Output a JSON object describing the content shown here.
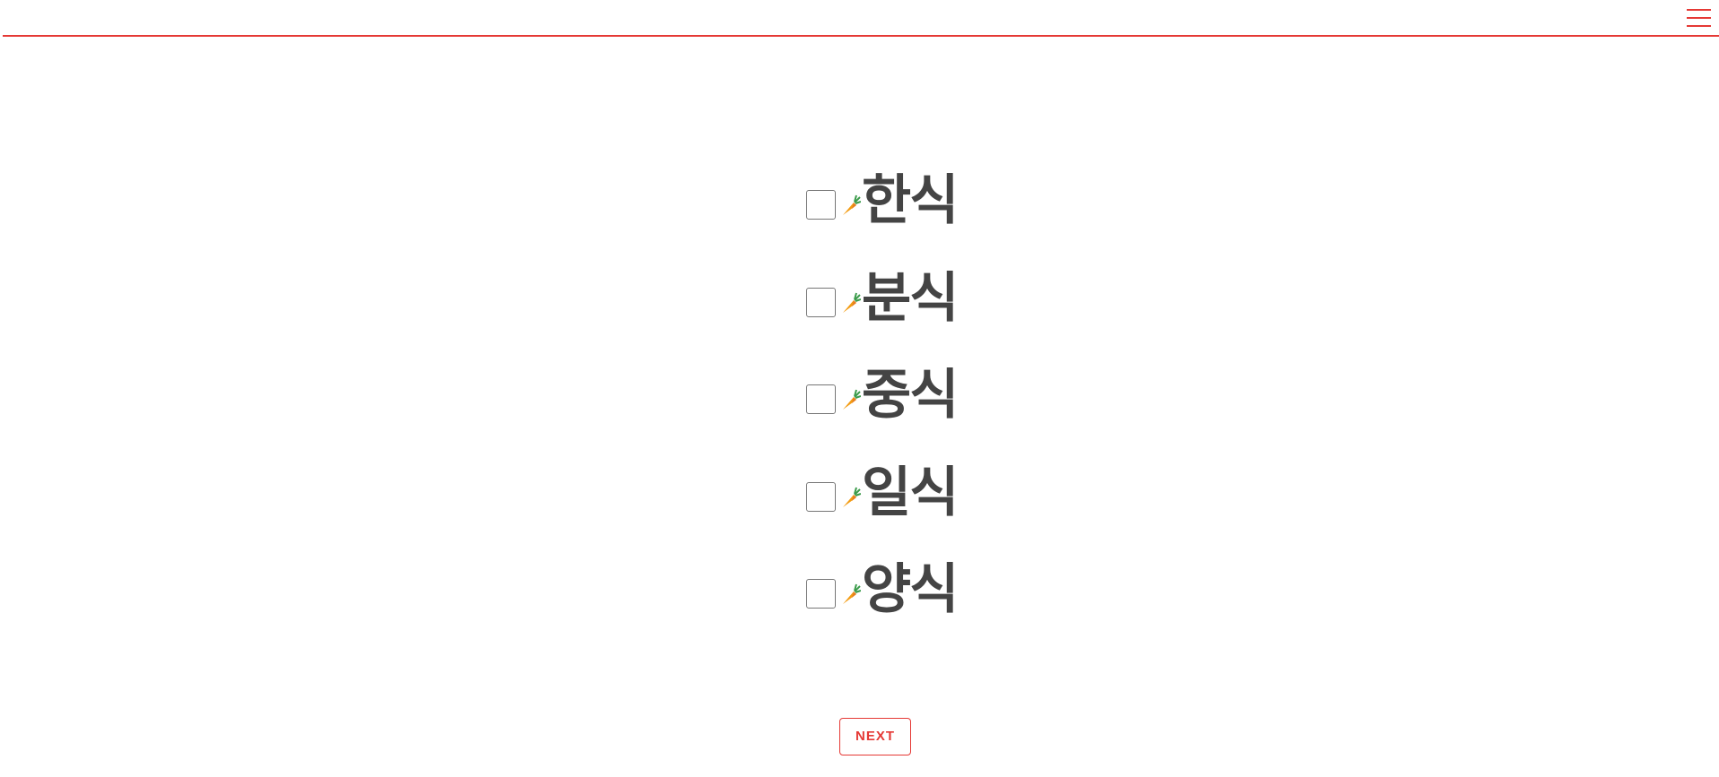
{
  "header": {
    "menu_icon": "hamburger-menu-icon",
    "accent_color": "#e53935"
  },
  "options": [
    {
      "label": "한식",
      "checked": false,
      "icon": "carrot-icon"
    },
    {
      "label": "분식",
      "checked": false,
      "icon": "carrot-icon"
    },
    {
      "label": "중식",
      "checked": false,
      "icon": "carrot-icon"
    },
    {
      "label": "일식",
      "checked": false,
      "icon": "carrot-icon"
    },
    {
      "label": "양식",
      "checked": false,
      "icon": "carrot-icon"
    }
  ],
  "footer": {
    "next_label": "NEXT"
  }
}
